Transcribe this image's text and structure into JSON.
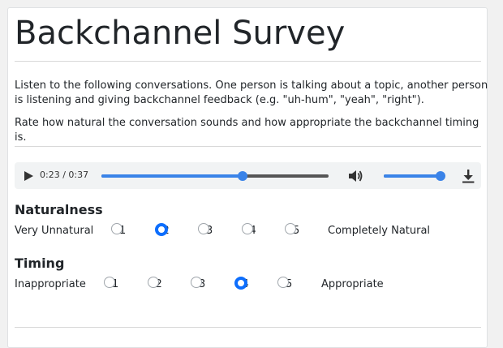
{
  "survey": {
    "title": "Backchannel Survey",
    "instructions": "Listen to the following conversations. One person is talking about a topic, another person is listening and giving backchannel feedback (e.g. \"uh-hum\", \"yeah\", \"right\").",
    "rating_prompt": "Rate how natural the conversation sounds and how appropriate the backchannel timing is."
  },
  "player": {
    "time": "0:23 / 0:37",
    "progress": 0.62,
    "volume": 1.0,
    "accent": "#3a83e8"
  },
  "naturalness": {
    "label": "Naturalness",
    "low": "Very Unnatural",
    "high": "Completely Natural",
    "options": [
      "1",
      "2",
      "3",
      "4",
      "5"
    ],
    "selected": "2"
  },
  "timing": {
    "label": "Timing",
    "low": "Inappropriate",
    "high": "Appropriate",
    "options": [
      "1",
      "2",
      "3",
      "4",
      "5"
    ],
    "selected": "4"
  },
  "colors": {
    "radio_checked": "#0d6efd"
  }
}
